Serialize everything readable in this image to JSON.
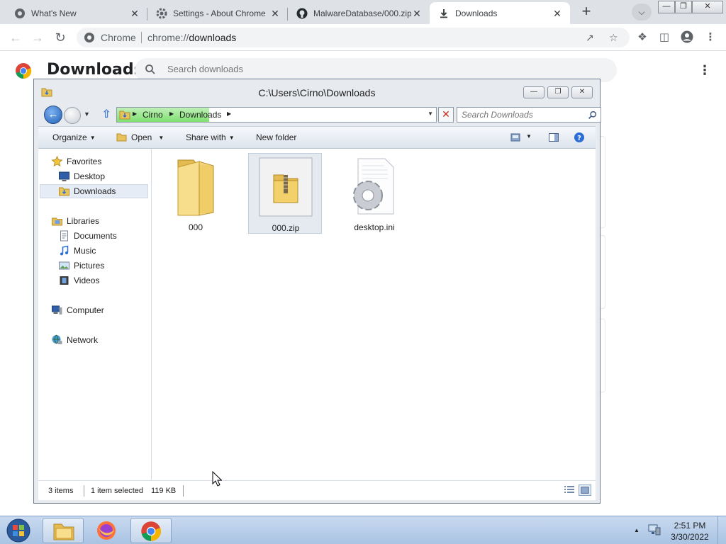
{
  "browser": {
    "tabs": [
      {
        "title": "What's New",
        "icon": "chrome-icon",
        "active": false
      },
      {
        "title": "Settings - About Chrome",
        "icon": "gear-icon",
        "active": false
      },
      {
        "title": "MalwareDatabase/000.zip",
        "icon": "github-icon",
        "active": false
      },
      {
        "title": "Downloads",
        "icon": "download-icon",
        "active": true
      }
    ],
    "close_glyph": "✕",
    "omnibox": {
      "site_label": "Chrome",
      "url_scheme": "chrome://",
      "url_path": "downloads"
    }
  },
  "downloads_page": {
    "title": "Downloads",
    "search_placeholder": "Search downloads"
  },
  "explorer": {
    "title": "C:\\Users\\Cirno\\Downloads",
    "breadcrumb": [
      "Cirno",
      "Downloads"
    ],
    "search_placeholder": "Search Downloads",
    "commands": {
      "organize": "Organize",
      "open": "Open",
      "share_with": "Share with",
      "new_folder": "New folder"
    },
    "nav": {
      "favorites": "Favorites",
      "desktop": "Desktop",
      "downloads": "Downloads",
      "libraries": "Libraries",
      "documents": "Documents",
      "music": "Music",
      "pictures": "Pictures",
      "videos": "Videos",
      "computer": "Computer",
      "network": "Network"
    },
    "files": [
      {
        "name": "000",
        "type": "folder"
      },
      {
        "name": "000.zip",
        "type": "zip",
        "selected": true
      },
      {
        "name": "desktop.ini",
        "type": "settings-file"
      }
    ],
    "status": {
      "item_count": "3 items",
      "selection": "1 item selected",
      "size": "119 KB"
    }
  },
  "taskbar": {
    "time": "2:51 PM",
    "date": "3/30/2022"
  },
  "colors": {
    "chrome_tab_strip": "#dee1e6",
    "taskbar": "#b9cfeb",
    "selection": "#e5ecf5"
  }
}
